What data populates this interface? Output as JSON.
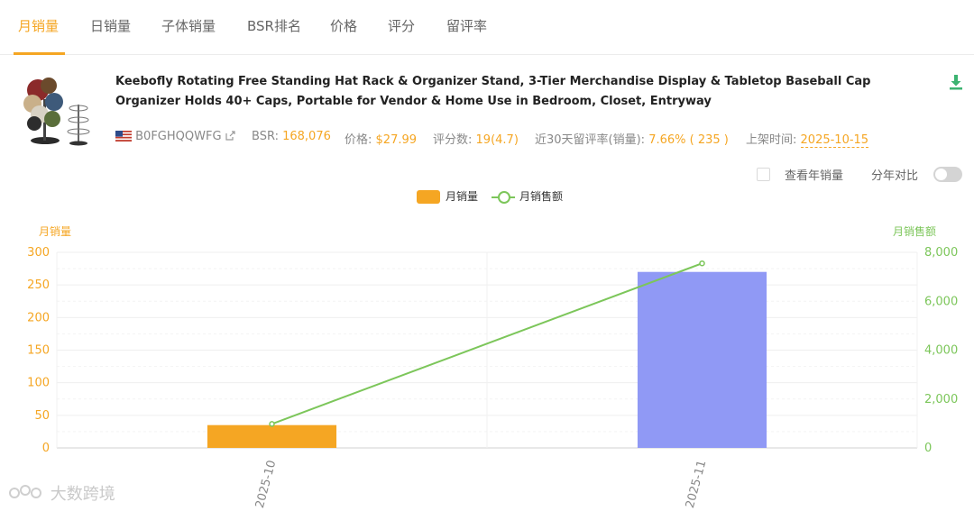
{
  "tabs": [
    {
      "label": "月销量",
      "active": true
    },
    {
      "label": "日销量"
    },
    {
      "label": "子体销量"
    },
    {
      "label": "BSR排名"
    },
    {
      "label": "价格"
    },
    {
      "label": "评分"
    },
    {
      "label": "留评率"
    }
  ],
  "product": {
    "title": "Keebofly Rotating Free Standing Hat Rack & Organizer Stand, 3-Tier Merchandise Display & Tabletop Baseball Cap Organizer Holds 40+ Caps, Portable for Vendor & Home Use in Bedroom, Closet, Entryway",
    "asin": "B0FGHQQWFG",
    "bsr_label": "BSR:",
    "bsr_value": "168,076",
    "price_label": "价格:",
    "price_value": "$27.99",
    "reviews_label": "评分数:",
    "reviews_value": "19(4.7)",
    "review_rate_label": "近30天留评率(销量):",
    "review_rate_value": "7.66% ( 235 )",
    "listed_label": "上架时间:",
    "listed_value": "2025-10-15"
  },
  "options": {
    "yearly_label": "查看年销量",
    "compare_label": "分年对比"
  },
  "legend": {
    "units": "月销量",
    "revenue": "月销售额"
  },
  "watermark": "大数跨境",
  "colors": {
    "accent": "#f5a623",
    "bar_current": "#9099f5",
    "line": "#7cc65a"
  },
  "chart_data": {
    "type": "bar",
    "categories": [
      "2025-10",
      "2025-11"
    ],
    "series": [
      {
        "name": "月销量",
        "type": "bar",
        "axis": "left",
        "values": [
          35,
          270
        ]
      },
      {
        "name": "月销售额",
        "type": "line",
        "axis": "right",
        "values": [
          980,
          7550
        ]
      }
    ],
    "ylabel": "月销量",
    "ylabel_right": "月销售额",
    "ylim": [
      0,
      300
    ],
    "ylim_right": [
      0,
      8000
    ],
    "yticks": [
      "0",
      "50",
      "100",
      "150",
      "200",
      "250",
      "300"
    ],
    "yticks_right": [
      "0",
      "2,000",
      "4,000",
      "6,000",
      "8,000"
    ],
    "grid": true,
    "legend": "top-center"
  }
}
